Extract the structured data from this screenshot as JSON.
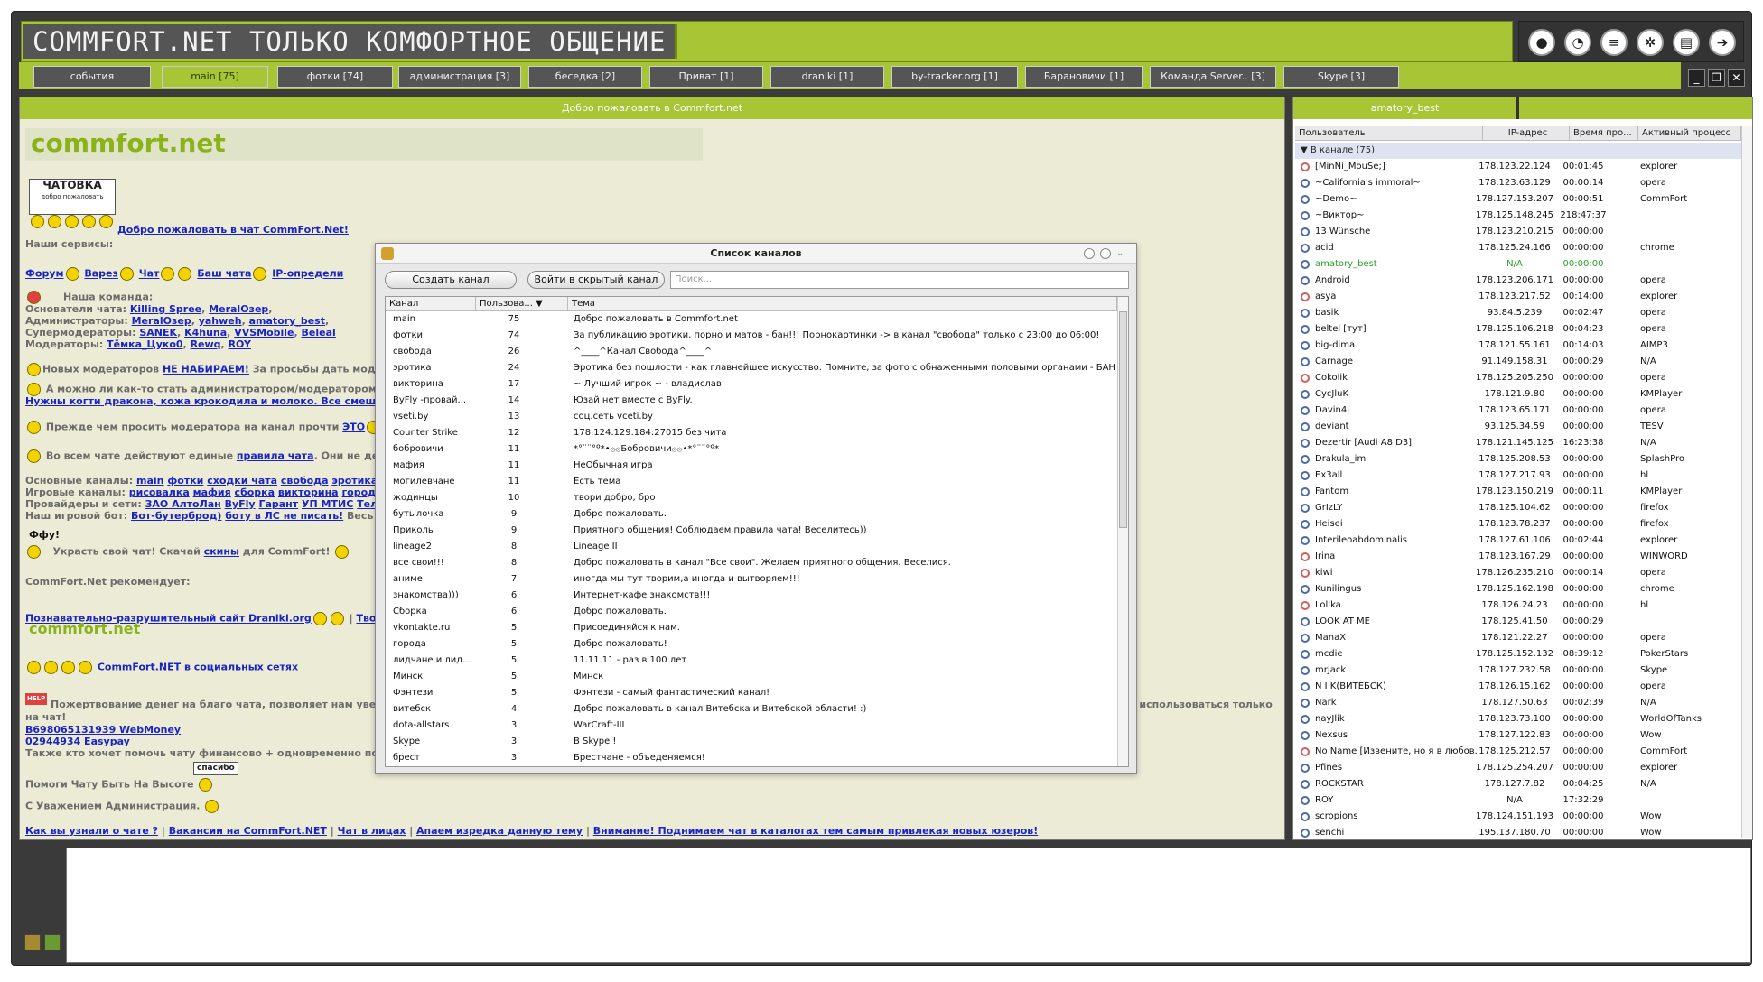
{
  "app_title": "COMMFORT.NET ТОЛЬКО КОМФОРТНОЕ ОБЩЕНИЕ",
  "top_icons": [
    {
      "name": "user-icon"
    },
    {
      "name": "chat-bubble-icon"
    },
    {
      "name": "list-icon"
    },
    {
      "name": "gear-icon"
    },
    {
      "name": "note-icon"
    },
    {
      "name": "exit-icon"
    }
  ],
  "tabs": [
    {
      "label": "события"
    },
    {
      "label": "main [75]",
      "active": true
    },
    {
      "label": "фотки [74]"
    },
    {
      "label": "администрация [3]"
    },
    {
      "label": "беседка [2]"
    },
    {
      "label": "Приват [1]"
    },
    {
      "label": "draniki [1]"
    },
    {
      "label": "by-tracker.org [1]"
    },
    {
      "label": "Барановичи [1]"
    },
    {
      "label": "Команда Server.. [3]"
    },
    {
      "label": "Skype [3]"
    }
  ],
  "window_buttons": [
    "_",
    "❐",
    "✕"
  ],
  "chat": {
    "header": "Добро пожаловать в Commfort.net",
    "logo_a": "commfort",
    "logo_b": ".net",
    "badge_top": "ЧАТОВКА",
    "badge_sub": "добро пожаловать",
    "welcome_link": "Добро пожаловать в чат CommFort.Net!",
    "services_label": "Наши сервисы:",
    "services": [
      "Форум",
      "Варез",
      "Чат",
      "Баш чата",
      "IP-определи"
    ],
    "team_label": "Наша команда:",
    "founders_label": "Основатели чата:",
    "founders": [
      "Killing Spree",
      "MeralOзер"
    ],
    "admins_label": "Администраторы:",
    "admins": [
      "MeralOзер",
      "yahweh",
      "amatory_best"
    ],
    "supermods_label": "Супермодераторы:",
    "supermods": [
      "SANEK",
      "K4huna",
      "VVSMobile",
      "Beleal"
    ],
    "mods_label": "Модераторы:",
    "mods": [
      "Тёмка_Цуко0",
      "Rewq",
      "ROY"
    ],
    "new_mods_text": "Новых модераторов",
    "new_mods_link": "НЕ НАБИРАЕМ!",
    "new_mods_tail": "За просьбы дать моде",
    "become_admin_text": "А можно ли как-то стать администратором/модератором",
    "become_admin_link": "Нужны когти дракона, кожа крокодила и молоко. Все смешать,",
    "ask_mod_text": "Прежде чем просить модератора на канал прочти",
    "ask_mod_link": "ЭТО",
    "rules_text": "Во всем чате действуют единые",
    "rules_link": "правила чата",
    "rules_tail": ". Они не дей",
    "main_channels_label": "Основные каналы:",
    "main_channels": [
      "main",
      "фотки",
      "сходки чата",
      "свобода",
      "эротика"
    ],
    "game_channels_label": "Игровые каналы:",
    "game_channels": [
      "рисовалка",
      "мафия",
      "сборка",
      "викторина",
      "города"
    ],
    "providers_label": "Провайдеры и сети:",
    "providers": [
      "ЗАО АлтоЛан",
      "ByFly",
      "Гарант",
      "УП МТИС",
      "ТелеСе"
    ],
    "game_server_label": "Наш игровой бот:",
    "game_server_link": "Бот-бутерброд)",
    "game_server_link2": "боту в ЛС не писать!",
    "game_server_tail": "Весь спи",
    "fufu": "Ффу!",
    "stolen_text": "Украсть свой чат! Скачай",
    "stolen_link": "скины",
    "stolen_tail": "для CommFort!",
    "recommends": "CommFort.Net рекомендует:",
    "draniki_link": "Познавательно-разрушительный сайт Draniki.org",
    "tvoi_link": "Твои т",
    "social_link": "CommFort.NET в социальных сетях",
    "help_badge": "HELP",
    "donate_text": "Пожертвование денег на благо чата, позволяет нам уве",
    "donate_cont": "на чат!",
    "donate_tail": "ут использоваться только",
    "wm_link": "В698065131939 WebMoney",
    "easypay_link": "02944934 Easypay",
    "help_finance": "Также кто хочет помочь чату финансово + одновременно помо",
    "help_chat": "Помоги Чату Быть На Высоте",
    "thanks_badge": "спасибо",
    "regards": "С Уважением Администрация.",
    "footer_links": [
      "Как вы узнали о чате ?",
      "Вакансии на CommFort.NET",
      "Чат в лицах",
      "Апаем изредка данную тему",
      "Внимание! Поднимаем чат в каталогах тем самым привлекая новых юзеров!"
    ]
  },
  "users": {
    "header": "amatory_best",
    "columns": [
      "Пользователь",
      "IP-адрес",
      "Время про...",
      "Активный процесс"
    ],
    "group": "В канале (75)",
    "rows": [
      {
        "name": "[MinNi_MouSe;]",
        "ip": "178.123.22.124",
        "time": "00:01:45",
        "proc": "explorer",
        "f": true
      },
      {
        "name": "~California's immoral~",
        "ip": "178.123.63.129",
        "time": "00:00:14",
        "proc": "opera"
      },
      {
        "name": "~Demo~",
        "ip": "178.127.153.207",
        "time": "00:00:51",
        "proc": "CommFort"
      },
      {
        "name": "~Виктор~",
        "ip": "178.125.148.245",
        "time": "218:47:37",
        "proc": ""
      },
      {
        "name": "13 Wünsche",
        "ip": "178.123.210.215",
        "time": "00:00:00",
        "proc": ""
      },
      {
        "name": "acid",
        "ip": "178.125.24.166",
        "time": "00:00:00",
        "proc": "chrome"
      },
      {
        "name": "amatory_best",
        "ip": "N/A",
        "time": "00:00:00",
        "proc": "",
        "hl": true
      },
      {
        "name": "Android",
        "ip": "178.123.206.171",
        "time": "00:00:00",
        "proc": "opera"
      },
      {
        "name": "asya",
        "ip": "178.123.217.52",
        "time": "00:14:00",
        "proc": "explorer",
        "f": true
      },
      {
        "name": "basik",
        "ip": "93.84.5.239",
        "time": "00:02:47",
        "proc": "opera"
      },
      {
        "name": "beltel [тут]",
        "ip": "178.125.106.218",
        "time": "00:04:23",
        "proc": "opera"
      },
      {
        "name": "big-dima",
        "ip": "178.121.55.161",
        "time": "00:14:03",
        "proc": "AIMP3"
      },
      {
        "name": "Carnage",
        "ip": "91.149.158.31",
        "time": "00:00:29",
        "proc": "N/A"
      },
      {
        "name": "Cokolik",
        "ip": "178.125.205.250",
        "time": "00:00:00",
        "proc": "opera",
        "f": true
      },
      {
        "name": "CycJluK",
        "ip": "178.121.9.80",
        "time": "00:00:00",
        "proc": "KMPlayer"
      },
      {
        "name": "Davin4i",
        "ip": "178.123.65.171",
        "time": "00:00:00",
        "proc": "opera"
      },
      {
        "name": "deviant",
        "ip": "93.125.34.59",
        "time": "00:00:00",
        "proc": "TESV"
      },
      {
        "name": "Dezertir [Audi A8 D3]",
        "ip": "178.121.145.125",
        "time": "16:23:38",
        "proc": "N/A"
      },
      {
        "name": "Drakula_im",
        "ip": "178.125.208.53",
        "time": "00:00:00",
        "proc": "SplashPro"
      },
      {
        "name": "Ex3all",
        "ip": "178.127.217.93",
        "time": "00:00:00",
        "proc": "hl"
      },
      {
        "name": "Fantom",
        "ip": "178.123.150.219",
        "time": "00:00:11",
        "proc": "KMPlayer"
      },
      {
        "name": "GrIzLY",
        "ip": "178.125.104.62",
        "time": "00:00:00",
        "proc": "firefox"
      },
      {
        "name": "Heisei",
        "ip": "178.123.78.237",
        "time": "00:00:00",
        "proc": "firefox"
      },
      {
        "name": "Interileoabdominalis",
        "ip": "178.127.61.106",
        "time": "00:02:44",
        "proc": "explorer"
      },
      {
        "name": "Irina",
        "ip": "178.123.167.29",
        "time": "00:00:00",
        "proc": "WINWORD",
        "f": true
      },
      {
        "name": "kiwi",
        "ip": "178.126.235.210",
        "time": "00:00:14",
        "proc": "opera",
        "f": true
      },
      {
        "name": "Kunilingus",
        "ip": "178.125.162.198",
        "time": "00:00:00",
        "proc": "chrome"
      },
      {
        "name": "Lollka",
        "ip": "178.126.24.23",
        "time": "00:00:00",
        "proc": "hl",
        "f": true
      },
      {
        "name": "LOOK AT ME",
        "ip": "178.125.41.50",
        "time": "00:00:29",
        "proc": ""
      },
      {
        "name": "ManaX",
        "ip": "178.121.22.27",
        "time": "00:00:00",
        "proc": "opera"
      },
      {
        "name": "mcdie",
        "ip": "178.125.152.132",
        "time": "08:39:12",
        "proc": "PokerStars"
      },
      {
        "name": "mrJack",
        "ip": "178.127.232.58",
        "time": "00:00:00",
        "proc": "Skype"
      },
      {
        "name": "N I K(ВИТЕБСК)",
        "ip": "178.126.15.162",
        "time": "00:00:00",
        "proc": "opera"
      },
      {
        "name": "Nark",
        "ip": "178.127.50.63",
        "time": "00:02:39",
        "proc": "N/A"
      },
      {
        "name": "nayJlik",
        "ip": "178.123.73.100",
        "time": "00:00:00",
        "proc": "WorldOfTanks"
      },
      {
        "name": "Nexsus",
        "ip": "178.127.122.83",
        "time": "00:00:00",
        "proc": "Wow"
      },
      {
        "name": "No Name [Извените, но я в любов...",
        "ip": "178.125.212.57",
        "time": "00:00:00",
        "proc": "CommFort",
        "f": true
      },
      {
        "name": "Pfines",
        "ip": "178.125.254.207",
        "time": "00:00:00",
        "proc": "explorer"
      },
      {
        "name": "ROCKSTAR",
        "ip": "178.127.7.82",
        "time": "00:04:25",
        "proc": "N/A"
      },
      {
        "name": "ROY",
        "ip": "N/A",
        "time": "17:32:29",
        "proc": ""
      },
      {
        "name": "scropions",
        "ip": "178.124.151.193",
        "time": "00:00:00",
        "proc": "Wow"
      },
      {
        "name": "senchi",
        "ip": "195.137.180.70",
        "time": "00:00:00",
        "proc": "Wow"
      }
    ]
  },
  "dialog": {
    "title": "Список каналов",
    "create_btn": "Создать канал",
    "hidden_btn": "Войти в скрытый канал",
    "search_placeholder": "Поиск...",
    "columns": [
      "Канал",
      "Пользова... ▼",
      "Тема"
    ],
    "rows": [
      {
        "ch": "main",
        "n": "75",
        "topic": "Добро пожаловать в Commfort.net"
      },
      {
        "ch": "фотки",
        "n": "74",
        "topic": "За публикацию эротики, порно и матов - бан!!! Порнокартинки -> в канал \"свобода\" только с 23:00 до 06:00!"
      },
      {
        "ch": "свобода",
        "n": "26",
        "topic": "^____^Канал Свобода^____^"
      },
      {
        "ch": "эротика",
        "n": "24",
        "topic": "Эротика без пошлости - как главнейшее искусство. Помните, за фото с обнаженными половыми органами - БАН!!!..."
      },
      {
        "ch": "викторина",
        "n": "17",
        "topic": "~ Лучший игрок ~ - владислав"
      },
      {
        "ch": "ByFly -провай...",
        "n": "14",
        "topic": "Юзай нет вместе с ByFly."
      },
      {
        "ch": "vseti.by",
        "n": "13",
        "topic": "соц.сеть vceti.by"
      },
      {
        "ch": "Counter Strike",
        "n": "12",
        "topic": "178.124.129.184:27015 без чита"
      },
      {
        "ch": "бобровичи",
        "n": "11",
        "topic": "*°¨¨°º*•۞۞Бобровичи۞۞•*°¨¨°º*"
      },
      {
        "ch": "мафия",
        "n": "11",
        "topic": "НеОбычная игра"
      },
      {
        "ch": "могилевчане",
        "n": "11",
        "topic": "Есть тема"
      },
      {
        "ch": "жодинцы",
        "n": "10",
        "topic": "твори добро, бро"
      },
      {
        "ch": "бутылочка",
        "n": "9",
        "topic": "Добро пожаловать."
      },
      {
        "ch": "Приколы",
        "n": "9",
        "topic": "Приятного общения! Соблюдаем правила чата! Веселитесь))"
      },
      {
        "ch": "lineage2",
        "n": "8",
        "topic": "Lineage II"
      },
      {
        "ch": "все свои!!!",
        "n": "8",
        "topic": "Добро пожаловать в канал \"Все свои\". Желаем приятного общения. Веселися."
      },
      {
        "ch": "аниме",
        "n": "7",
        "topic": "иногда мы тут творим,а иногда и вытворяем!!!"
      },
      {
        "ch": "знакомства)))",
        "n": "6",
        "topic": "Интернет-кафе знакомств!!!"
      },
      {
        "ch": "Сборка",
        "n": "6",
        "topic": "Добро пожаловать."
      },
      {
        "ch": "vkontakte.ru",
        "n": "5",
        "topic": "Присоединяйся к нам."
      },
      {
        "ch": "города",
        "n": "5",
        "topic": "Добро пожаловать!"
      },
      {
        "ch": "лидчане и лид...",
        "n": "5",
        "topic": "11.11.11 - раз в 100 лет"
      },
      {
        "ch": "Минск",
        "n": "5",
        "topic": "Минск"
      },
      {
        "ch": "Фэнтези",
        "n": "5",
        "topic": "Фэнтези - самый фантастический канал!"
      },
      {
        "ch": "витебск",
        "n": "4",
        "topic": "Добро пожаловать в канал Витебска и Витебской области! :)"
      },
      {
        "ch": "dota-allstars",
        "n": "3",
        "topic": "WarCraft-III"
      },
      {
        "ch": "Skype",
        "n": "3",
        "topic": "В Skype !"
      },
      {
        "ch": "брест",
        "n": "3",
        "topic": "Брестчане - объеденяемся!"
      }
    ]
  }
}
